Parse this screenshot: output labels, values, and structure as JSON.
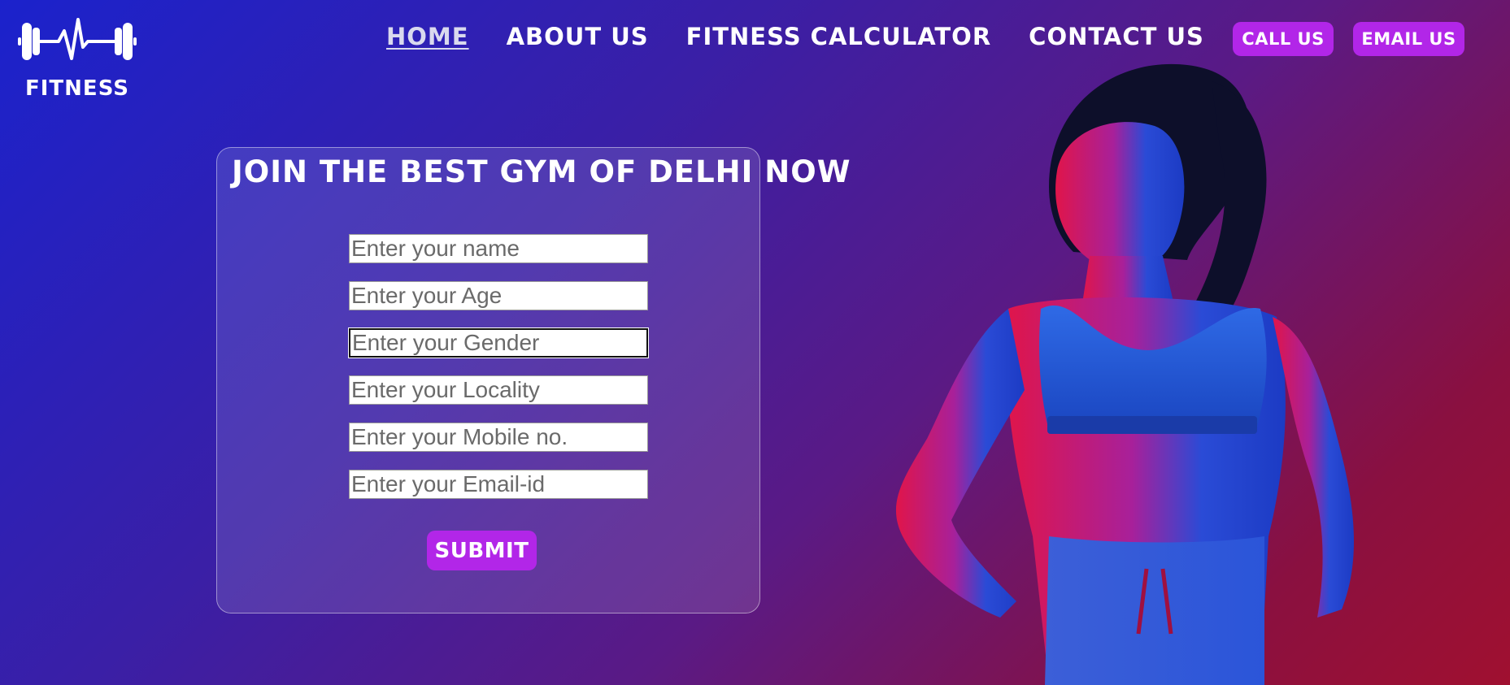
{
  "brand": {
    "name": "FITNESS",
    "logo_icon": "dumbbell-heartbeat-icon"
  },
  "nav": {
    "items": [
      {
        "label": "HOME",
        "active": true
      },
      {
        "label": "ABOUT US"
      },
      {
        "label": "FITNESS CALCULATOR"
      },
      {
        "label": "CONTACT US"
      }
    ]
  },
  "actions": {
    "call": "CALL US",
    "email": "EMAIL US"
  },
  "form": {
    "title": "JOIN THE BEST GYM OF DELHI NOW",
    "fields": [
      {
        "placeholder": "Enter your name"
      },
      {
        "placeholder": "Enter your Age"
      },
      {
        "placeholder": "Enter your Gender",
        "focused": true
      },
      {
        "placeholder": "Enter your Locality"
      },
      {
        "placeholder": "Enter your Mobile no."
      },
      {
        "placeholder": "Enter your Email-id"
      }
    ],
    "submit": "SUBMIT"
  },
  "colors": {
    "accent": "#b226e8",
    "bg_start": "#1b22cc",
    "bg_end": "#a01030"
  }
}
